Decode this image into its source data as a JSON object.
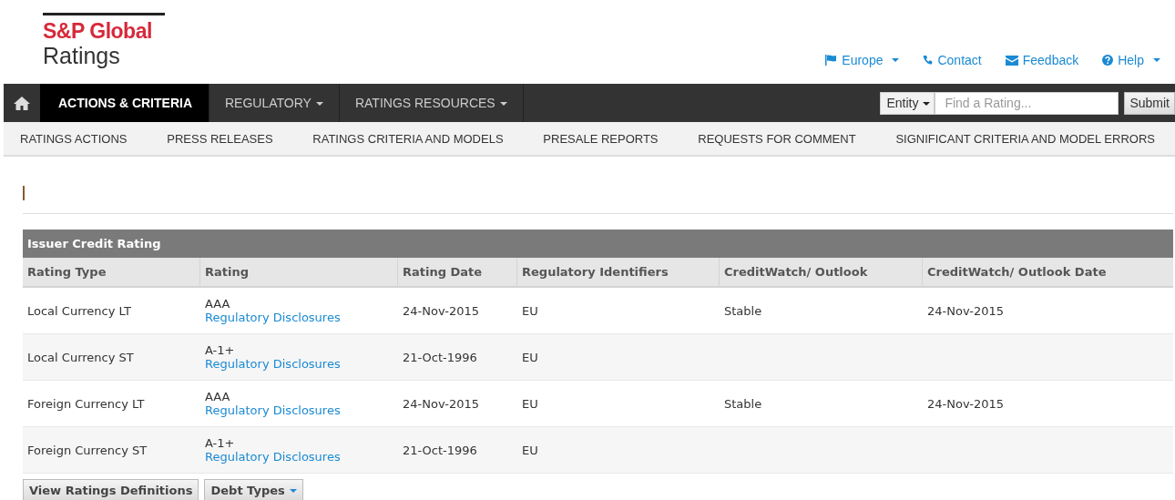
{
  "logo": {
    "brand": "S&P Global",
    "product": "Ratings"
  },
  "top_links": [
    {
      "label": "Europe",
      "kind": "region",
      "dropdown": true
    },
    {
      "label": "Contact",
      "kind": "contact",
      "dropdown": false
    },
    {
      "label": "Feedback",
      "kind": "feedback",
      "dropdown": false
    },
    {
      "label": "Help",
      "kind": "help",
      "dropdown": true
    }
  ],
  "nav": {
    "tabs": [
      {
        "label": "ACTIONS & CRITERIA",
        "selected": true,
        "dropdown": false
      },
      {
        "label": "REGULATORY",
        "selected": false,
        "dropdown": true
      },
      {
        "label": "RATINGS RESOURCES",
        "selected": false,
        "dropdown": true
      }
    ],
    "search": {
      "scope": "Entity",
      "placeholder": "Find a Rating...",
      "submit": "Submit"
    }
  },
  "subnav": [
    "RATINGS ACTIONS",
    "PRESS RELEASES",
    "RATINGS CRITERIA AND MODELS",
    "PRESALE REPORTS",
    "REQUESTS FOR COMMENT",
    "SIGNIFICANT CRITERIA AND MODEL ERRORS"
  ],
  "table": {
    "title": "Issuer Credit Rating",
    "columns": [
      "Rating Type",
      "Rating",
      "Rating Date",
      "Regulatory Identifiers",
      "CreditWatch/ Outlook",
      "CreditWatch/ Outlook Date"
    ],
    "rows": [
      {
        "rating_type": "Local Currency LT",
        "rating": "AAA",
        "link": "Regulatory Disclosures",
        "rating_date": "24-Nov-2015",
        "regulatory_identifiers": "EU",
        "outlook": "Stable",
        "outlook_date": "24-Nov-2015"
      },
      {
        "rating_type": "Local Currency ST",
        "rating": "A-1+",
        "link": "Regulatory Disclosures",
        "rating_date": "21-Oct-1996",
        "regulatory_identifiers": "EU"
      },
      {
        "rating_type": "Foreign Currency LT",
        "rating": "AAA",
        "link": "Regulatory Disclosures",
        "rating_date": "24-Nov-2015",
        "regulatory_identifiers": "EU",
        "outlook": "Stable",
        "outlook_date": "24-Nov-2015"
      },
      {
        "rating_type": "Foreign Currency ST",
        "rating": "A-1+",
        "link": "Regulatory Disclosures",
        "rating_date": "21-Oct-1996",
        "regulatory_identifiers": "EU"
      }
    ]
  },
  "buttons": [
    {
      "label": "View Ratings Definitions",
      "dropdown": false
    },
    {
      "label": "Debt Types",
      "dropdown": true
    }
  ]
}
